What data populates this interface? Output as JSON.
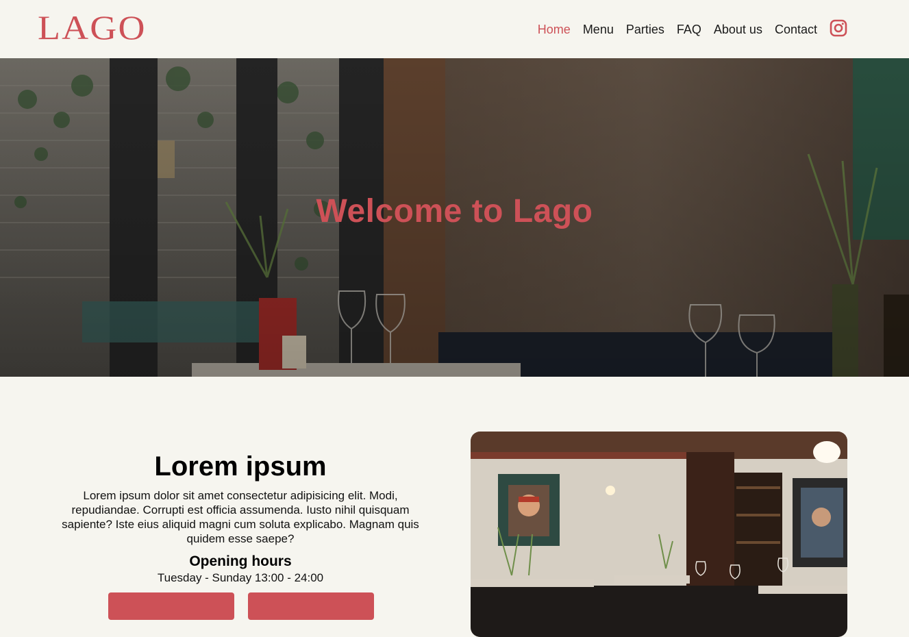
{
  "brand": {
    "logo": "LAGO",
    "color": "#cd5157"
  },
  "nav": {
    "items": [
      {
        "label": "Home",
        "active": true
      },
      {
        "label": "Menu",
        "active": false
      },
      {
        "label": "Parties",
        "active": false
      },
      {
        "label": "FAQ",
        "active": false
      },
      {
        "label": "About us",
        "active": false
      },
      {
        "label": "Contact",
        "active": false
      }
    ],
    "social_icon": "instagram-icon"
  },
  "hero": {
    "title": "Welcome to Lago"
  },
  "intro": {
    "heading": "Lorem ipsum",
    "body": "Lorem ipsum dolor sit amet consectetur adipisicing elit. Modi, repudiandae. Corrupti est officia assumenda. Iusto nihil quisquam sapiente? Iste eius aliquid magni cum soluta explicabo. Magnam quis quidem esse saepe?",
    "hours_title": "Opening hours",
    "hours": "Tuesday - Sunday 13:00 - 24:00",
    "buttons": [
      "",
      ""
    ]
  },
  "colors": {
    "background": "#f6f5ef",
    "accent": "#cd5157"
  }
}
